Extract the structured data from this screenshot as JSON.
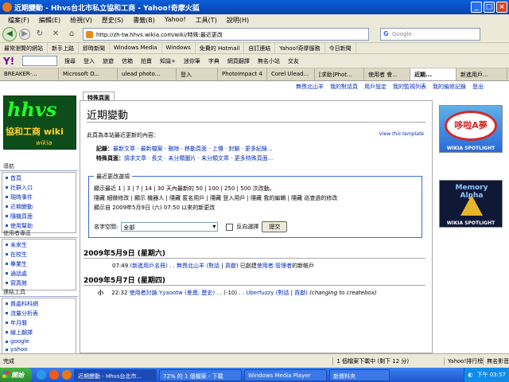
{
  "window": {
    "title": "近期變動 - Hhvs台北市私立協和工商 - Yahoo!奇摩火狐"
  },
  "menu": [
    "檔案(F)",
    "編輯(E)",
    "檢視(V)",
    "歷史(S)",
    "書籤(B)",
    "Yahoo!",
    "工具(T)",
    "說明(H)"
  ],
  "nav": {
    "url": "http://zh-tw.hhvs.wikia.com/wiki/特殊:最近更改",
    "search_placeholder": "Google"
  },
  "bookmarks": [
    "最常瀏覽的網站",
    "新手上路",
    "即時新聞",
    "Windows Media",
    "Windows",
    "免費的 Hotmail",
    "自訂連結",
    "Yahoo!奇摩服務",
    "今日新聞"
  ],
  "yahoo_toolbar": {
    "logo": "Y!",
    "items": [
      "搜尋",
      "登入",
      "旅遊",
      "信箱",
      "拍賣",
      "知識+",
      "迷你筆",
      "字典",
      "網頁翻譯",
      "無名小站",
      "交友"
    ]
  },
  "tabs": [
    {
      "label": "BREAKER-...",
      "active": false
    },
    {
      "label": "Microsoft O...",
      "active": false
    },
    {
      "label": "ulead photo...",
      "active": false
    },
    {
      "label": "登入",
      "active": false
    },
    {
      "label": "PhotoImpact 4",
      "active": false
    },
    {
      "label": "Corel Ulead...",
      "active": false
    },
    {
      "label": "[求助]Phot...",
      "active": false
    },
    {
      "label": "使用者 會...",
      "active": false
    },
    {
      "label": "近期...",
      "active": true
    },
    {
      "label": "新進用戶...",
      "active": false
    }
  ],
  "user_links": [
    "無畏北山羊",
    "我的對話頁",
    "用戶設定",
    "我的監視列表",
    "我的編修記錄",
    "登出"
  ],
  "logo": {
    "line1": "hhvs",
    "line2": "協和工商 wiki",
    "line3": "wikia"
  },
  "sidebar": {
    "nav_title": "導航",
    "nav_items": [
      "首頁",
      "社群入口",
      "現時事件",
      "近期變動",
      "隨機頁面",
      "使用幫助"
    ],
    "users_title": "使用者專區",
    "users_items": [
      "未來生",
      "在校生",
      "畢業生",
      "通話處",
      "寫真館"
    ],
    "tools_title": "連結工具",
    "tools_items": [
      "資處科科網",
      "流量分析表",
      "年月曆",
      "線上翻譯",
      "google",
      "yahoo"
    ]
  },
  "content_tab": "特殊頁面",
  "main": {
    "heading": "近期變動",
    "intro": "此頁為本站最近更新的內容：",
    "view_template": "View this template",
    "records_label": "記錄：",
    "records_links": "最新文章 · 最新檔案 · 刪除 · 移動頁面 · 上傳 · 封鎖 · 更多紀錄...",
    "special_label": "特殊頁面：",
    "special_links": "請求文章 · 長文 · 未分類圖片 · 未分類文章 · 更多特殊頁面..."
  },
  "options": {
    "legend": "最近更改選項",
    "line1": "顯示最近 1 | 3 | 7 | 14 | 30 天內最新的 50 | 100 | 250 | 500 次改動。",
    "line2": "隱藏 細微修改 | 顯示 機器人 | 隱藏 匿名用戶 | 隱藏 登入用戶 | 隱藏 我的編輯 | 隱藏 巡查過的修改",
    "line3": "顯示自 2009年5月9日 (六) 07:50 以來的新更改",
    "ns_label": "名字空間:",
    "ns_value": "全部",
    "invert_label": "反向選擇",
    "submit": "提交"
  },
  "days": [
    {
      "date": "2009年5月9日 (星期六)",
      "changes": [
        {
          "time": "07:49",
          "page": "(新進用戶名冊)",
          "sep": ". .",
          "user": "無畏北山羊",
          "talk": "(對話",
          "contribs": "貢獻)",
          "action": "已創建",
          "action_link": "使用者:管理者",
          "suffix": "的新帳戶"
        }
      ]
    },
    {
      "date": "2009年5月7日 (星期四)",
      "changes": [
        {
          "flag": "小",
          "time": "22:32",
          "page": "使用者討論:Yyaootw",
          "diff": "(差異; 歷史)",
          "size": ". . (-10) . .",
          "user": "Uberfuzzy",
          "talk": "(對話",
          "contribs": "貢獻)",
          "comment": "(changing to createbox)"
        }
      ]
    }
  ],
  "spotlights": [
    {
      "caption": "WIKIA SPOTLIGHT",
      "art": "哆啦A夢"
    },
    {
      "caption": "WIKIA SPOTLIGHT",
      "art": "Memory Alpha"
    }
  ],
  "status": {
    "text": "完成",
    "download": "1 個檔案下載中 (剩下 12 分)",
    "rank": "Yahoo!排行榜",
    "extra": "無名影音"
  },
  "taskbar": {
    "start": "開始",
    "items": [
      {
        "label": "近期變動 - Hhvs台北市...",
        "active": true
      },
      {
        "label": "72% 的 1 個檔案 - 下載",
        "active": false
      },
      {
        "label": "Windows Media Player",
        "active": false
      },
      {
        "label": "新資料夾",
        "active": false
      }
    ],
    "clock": "下午 03:57"
  }
}
